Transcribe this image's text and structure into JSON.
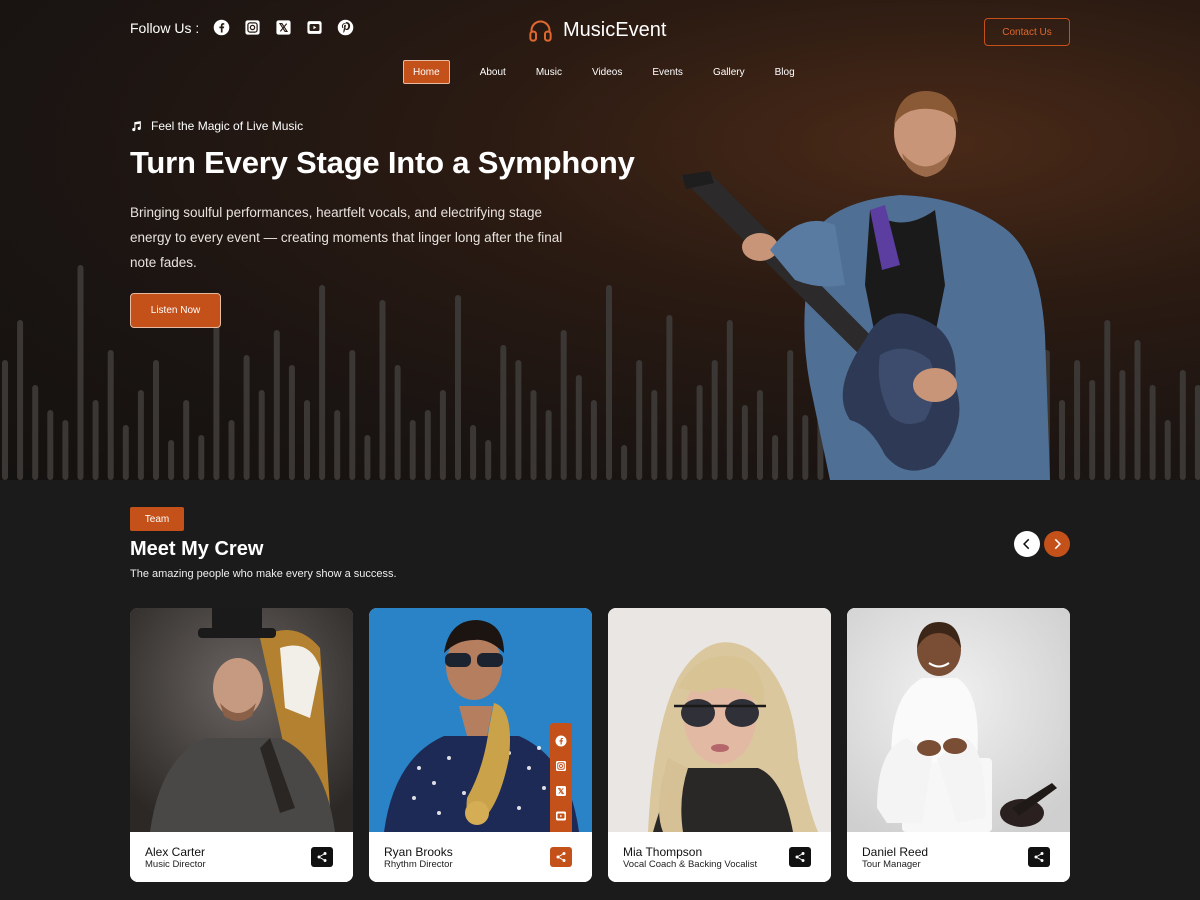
{
  "header": {
    "follow_label": "Follow Us :",
    "social_icons": [
      "facebook-icon",
      "instagram-icon",
      "x-icon",
      "youtube-icon",
      "pinterest-icon"
    ],
    "brand_name": "MusicEvent",
    "contact_label": "Contact Us"
  },
  "nav": {
    "items": [
      "Home",
      "About",
      "Music",
      "Videos",
      "Events",
      "Gallery",
      "Blog"
    ],
    "active": "Home"
  },
  "hero": {
    "tagline": "Feel the Magic of Live Music",
    "title": "Turn Every Stage Into a Symphony",
    "description": "Bringing soulful performances, heartfelt vocals, and electrifying stage energy to every event — creating moments that linger long after the final note fades.",
    "cta_label": "Listen Now"
  },
  "team": {
    "badge": "Team",
    "title": "Meet My Crew",
    "subtitle": "The amazing people who make every show a success.",
    "members": [
      {
        "name": "Alex Carter",
        "role": "Music Director"
      },
      {
        "name": "Ryan Brooks",
        "role": "Rhythm Director"
      },
      {
        "name": "Mia Thompson",
        "role": "Vocal Coach & Backing Vocalist"
      },
      {
        "name": "Daniel Reed",
        "role": "Tour Manager"
      }
    ]
  },
  "colors": {
    "accent": "#c4501a",
    "background": "#1b1b1b",
    "card": "#ffffff"
  }
}
